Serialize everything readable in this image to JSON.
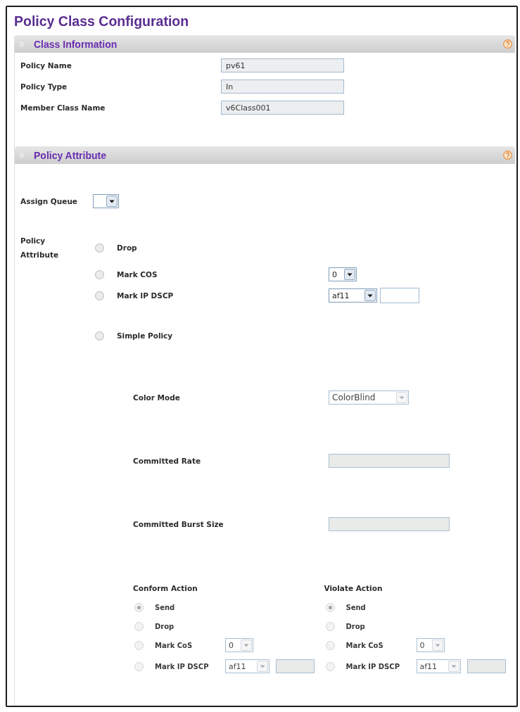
{
  "title": "Policy Class Configuration",
  "class_information": {
    "header": "Class Information",
    "fields": [
      {
        "label": "Policy Name",
        "value": "pv61"
      },
      {
        "label": "Policy Type",
        "value": "In"
      },
      {
        "label": "Member Class Name",
        "value": "v6Class001"
      }
    ]
  },
  "policy_attribute": {
    "header": "Policy Attribute",
    "assign_queue": {
      "label": "Assign Queue"
    },
    "attribute_label": "Policy Attribute",
    "options": [
      {
        "kind": "plain",
        "label": "Drop",
        "selected": false,
        "disabled": false
      },
      {
        "kind": "dropdown",
        "label": "Mark COS",
        "selected": false,
        "disabled": false,
        "dropdown_value": "0"
      },
      {
        "kind": "dropdown_input",
        "label": "Mark IP DSCP",
        "selected": false,
        "disabled": false,
        "dropdown_value": "af11"
      },
      {
        "kind": "plain",
        "label": "Simple Policy",
        "selected": false,
        "disabled": false
      }
    ],
    "simple_policy": {
      "fields": [
        {
          "kind": "dropdown",
          "label": "Color Mode",
          "value": "ColorBlind",
          "disabled": true
        },
        {
          "kind": "input",
          "label": "Committed Rate",
          "disabled": true
        },
        {
          "kind": "input",
          "label": "Committed Burst Size",
          "disabled": true
        }
      ],
      "actions": [
        {
          "title": "Conform Action",
          "options": [
            {
              "kind": "plain",
              "label": "Send",
              "selected": true,
              "disabled": true
            },
            {
              "kind": "plain",
              "label": "Drop",
              "selected": false,
              "disabled": true
            },
            {
              "kind": "dropdown",
              "label": "Mark CoS",
              "selected": false,
              "disabled": true,
              "dropdown_value": "0"
            },
            {
              "kind": "dropdown_input",
              "label": "Mark IP DSCP",
              "selected": false,
              "disabled": true,
              "dropdown_value": "af11"
            }
          ]
        },
        {
          "title": "Violate Action",
          "options": [
            {
              "kind": "plain",
              "label": "Send",
              "selected": true,
              "disabled": true
            },
            {
              "kind": "plain",
              "label": "Drop",
              "selected": false,
              "disabled": true
            },
            {
              "kind": "dropdown",
              "label": "Mark CoS",
              "selected": false,
              "disabled": true,
              "dropdown_value": "0"
            },
            {
              "kind": "dropdown_input",
              "label": "Mark IP DSCP",
              "selected": false,
              "disabled": true,
              "dropdown_value": "af11"
            }
          ]
        }
      ]
    }
  }
}
